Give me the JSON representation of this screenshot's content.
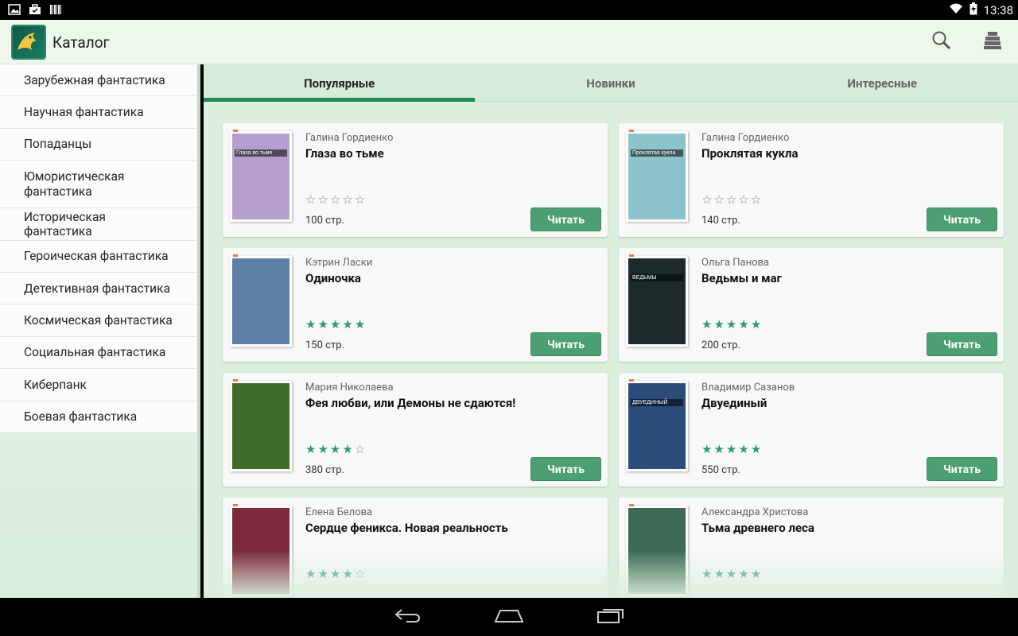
{
  "status_bar": {
    "time": "13:38",
    "icons_left": [
      "image-icon",
      "briefcase-icon",
      "barcode-icon"
    ],
    "icons_right": [
      "wifi-icon",
      "battery-charging-icon"
    ]
  },
  "app_bar": {
    "title": "Каталог",
    "logo": "dragon-logo-icon",
    "actions": [
      "search-icon",
      "books-stack-icon"
    ]
  },
  "sidebar": {
    "items": [
      {
        "label": "Зарубежная фантастика"
      },
      {
        "label": "Научная фантастика"
      },
      {
        "label": "Попаданцы"
      },
      {
        "label": "Юмористическая фантастика"
      },
      {
        "label": "Историческая фантастика"
      },
      {
        "label": "Героическая фантастика"
      },
      {
        "label": "Детективная фантастика"
      },
      {
        "label": "Космическая фантастика"
      },
      {
        "label": "Социальная фантастика"
      },
      {
        "label": "Киберпанк"
      },
      {
        "label": "Боевая фантастика"
      }
    ]
  },
  "tabs": [
    {
      "label": "Популярные",
      "active": true
    },
    {
      "label": "Новинки",
      "active": false
    },
    {
      "label": "Интересные",
      "active": false
    }
  ],
  "books": [
    {
      "author": "Галина Гордиенко",
      "title": "Глаза во тьме",
      "rating": 0,
      "pages": "100 стр.",
      "button": "Читать",
      "cover": {
        "bg": "#b69fcf",
        "cover_text": "Глаза во тьме"
      }
    },
    {
      "author": "Галина Гордиенко",
      "title": "Проклятая кукла",
      "rating": 0,
      "pages": "140 стр.",
      "button": "Читать",
      "cover": {
        "bg": "#8fc3cc",
        "cover_text": "Проклятая кукла"
      }
    },
    {
      "author": "Кэтрин Ласки",
      "title": "Одиночка",
      "rating": 5,
      "pages": "150 стр.",
      "button": "Читать",
      "cover": {
        "bg": "#5b7fa6"
      }
    },
    {
      "author": "Ольга Панова",
      "title": "Ведьмы и маг",
      "rating": 5,
      "pages": "200 стр.",
      "button": "Читать",
      "cover": {
        "bg": "#1c2a2a",
        "cover_text": "ВЕДЬМЫ"
      }
    },
    {
      "author": "Мария Николаева",
      "title": "Фея любви, или Демоны не сдаются!",
      "rating": 4,
      "pages": "380 стр.",
      "button": "Читать",
      "cover": {
        "bg": "#3f6b2a"
      }
    },
    {
      "author": "Владимир Сазанов",
      "title": "Двуединый",
      "rating": 5,
      "pages": "550 стр.",
      "button": "Читать",
      "cover": {
        "bg": "#2c4d7a",
        "cover_text": "ДВУЕДИНЫЙ"
      }
    },
    {
      "author": "Елена Белова",
      "title": "Сердце феникса. Новая реальность",
      "rating": 4,
      "pages": "",
      "button": "",
      "cover": {
        "bg": "#7a2a3a"
      }
    },
    {
      "author": "Александра Христова",
      "title": "Тьма древнего леса",
      "rating": 5,
      "pages": "",
      "button": "",
      "cover": {
        "bg": "#3d6a55"
      }
    }
  ],
  "nav_bar": [
    "back-icon",
    "home-icon",
    "recents-icon"
  ],
  "colors": {
    "accent": "#1f8a55",
    "button": "#4c9f72",
    "star": "#2e9a6a"
  }
}
